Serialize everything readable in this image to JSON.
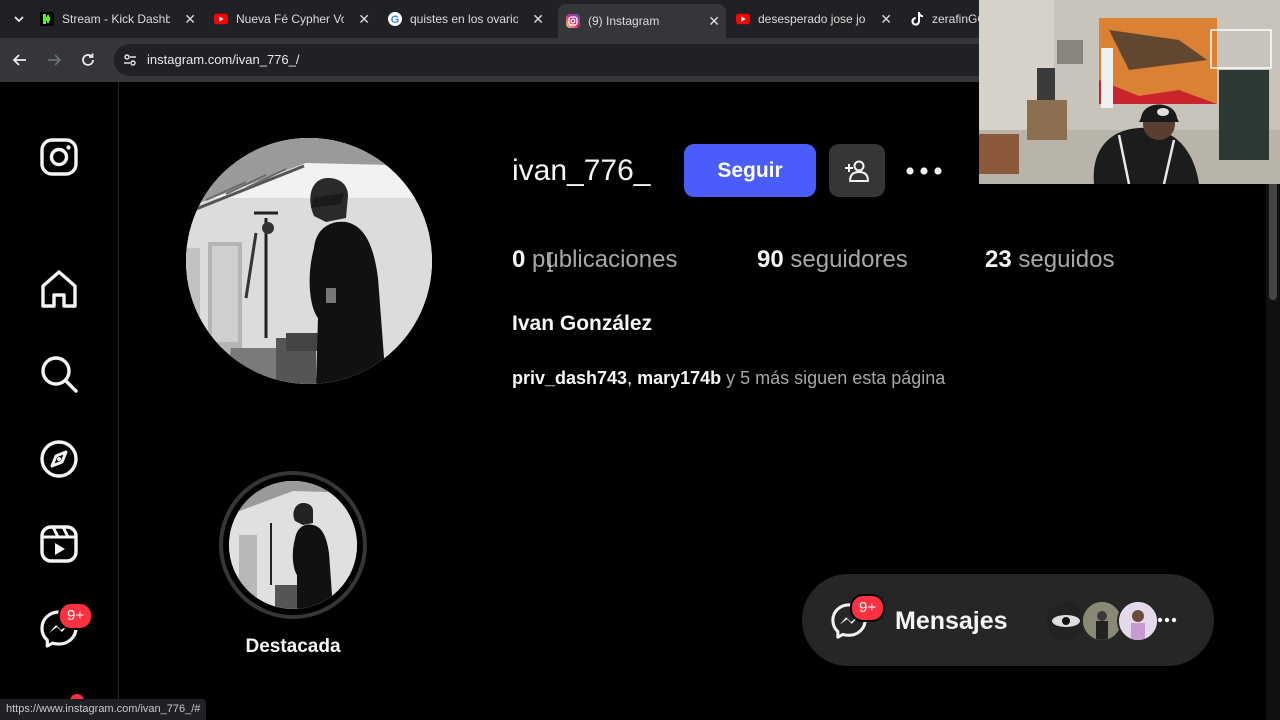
{
  "browser": {
    "tabs": [
      {
        "title": "Stream - Kick Dashboard",
        "icon": "kick-icon",
        "active": false
      },
      {
        "title": "Nueva Fé Cypher Vol",
        "icon": "youtube-icon",
        "active": false
      },
      {
        "title": "quistes en los ovarios",
        "icon": "google-icon",
        "active": false
      },
      {
        "title": "(9) Instagram",
        "icon": "instagram-icon",
        "active": true
      },
      {
        "title": "desesperado jose jose",
        "icon": "youtube-icon",
        "active": false
      },
      {
        "title": "zerafinGG",
        "icon": "tiktok-icon",
        "active": false
      }
    ],
    "url": "instagram.com/ivan_776_/",
    "status_url": "https://www.instagram.com/ivan_776_/#"
  },
  "sidebar": {
    "items": [
      {
        "name": "instagram-logo-icon"
      },
      {
        "name": "home-icon"
      },
      {
        "name": "search-icon"
      },
      {
        "name": "explore-icon"
      },
      {
        "name": "reels-icon"
      },
      {
        "name": "messenger-icon",
        "badge": "9+"
      }
    ]
  },
  "profile": {
    "username": "ivan_776_",
    "follow_label": "Seguir",
    "stats": {
      "posts_count": "0",
      "posts_label": "publicaciones",
      "followers_count": "90",
      "followers_label": "seguidores",
      "following_count": "23",
      "following_label": "seguidos"
    },
    "full_name": "Ivan González",
    "followed_by": {
      "user1": "priv_dash743",
      "separator": ", ",
      "user2": "mary174b",
      "suffix": " y 5 más siguen esta página"
    }
  },
  "highlights": [
    {
      "label": "Destacada"
    }
  ],
  "messages": {
    "label": "Mensajes",
    "badge": "9+"
  },
  "colors": {
    "accent_blue": "#4a5dfa",
    "notification_red": "#ff3040",
    "background": "#000000",
    "secondary_button": "#363636"
  }
}
